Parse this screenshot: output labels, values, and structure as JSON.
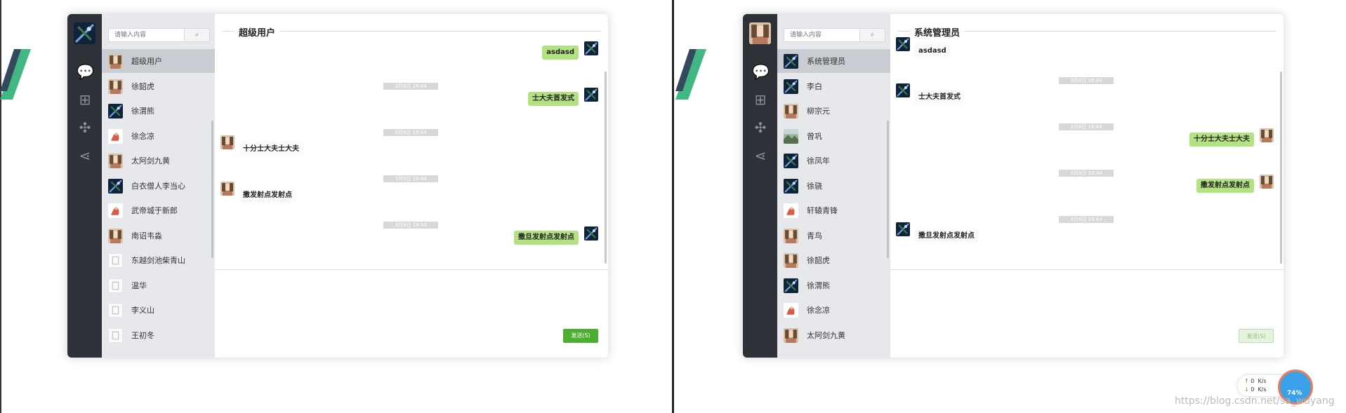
{
  "colors": {
    "rail": "#2e3238",
    "list_bg": "#e6e8ec",
    "active_item": "#c9ccd2",
    "my_bubble": "#b2e281",
    "send_button": "#4caf32"
  },
  "search": {
    "placeholder": "请输入内容",
    "icon": "search-icon"
  },
  "rail_icons": [
    "wechat-icon",
    "windows-icon",
    "pinwheel-icon",
    "share-icon"
  ],
  "left": {
    "title": "超级用户",
    "contacts": [
      {
        "name": "超级用户",
        "avatar": "girl",
        "active": true
      },
      {
        "name": "徐韶虎",
        "avatar": "girl"
      },
      {
        "name": "徐渭熊",
        "avatar": "stars"
      },
      {
        "name": "徐念凉",
        "avatar": "fox"
      },
      {
        "name": "太阿剑九黄",
        "avatar": "girl"
      },
      {
        "name": "白衣僧人李当心",
        "avatar": "stars"
      },
      {
        "name": "武帝城于新郎",
        "avatar": "fox"
      },
      {
        "name": "南诏韦淼",
        "avatar": "girl"
      },
      {
        "name": "东越剑池柴青山",
        "avatar": "blank"
      },
      {
        "name": "温华",
        "avatar": "blank"
      },
      {
        "name": "李义山",
        "avatar": "blank"
      },
      {
        "name": "王初冬",
        "avatar": "blank"
      }
    ],
    "messages": [
      {
        "kind": "msg",
        "side": "mine",
        "text": "asdasd",
        "avatar": "stars"
      },
      {
        "kind": "time",
        "text": "3月9日 19:44"
      },
      {
        "kind": "msg",
        "side": "mine",
        "text": "士大夫首发式",
        "avatar": "stars"
      },
      {
        "kind": "time",
        "text": "3月9日 19:44"
      },
      {
        "kind": "msg",
        "side": "other",
        "text": "十分士大夫士大夫",
        "avatar": "girl"
      },
      {
        "kind": "time",
        "text": "3月9日 19:44"
      },
      {
        "kind": "msg",
        "side": "other",
        "text": "撒发射点发射点",
        "avatar": "girl"
      },
      {
        "kind": "time",
        "text": "3月9日 19:44"
      },
      {
        "kind": "msg",
        "side": "mine",
        "text": "撒旦发射点发射点",
        "avatar": "stars"
      }
    ],
    "send_label": "发送(S)",
    "send_enabled": true
  },
  "right": {
    "title": "系统管理员",
    "contacts": [
      {
        "name": "系统管理员",
        "avatar": "stars",
        "active": true
      },
      {
        "name": "李白",
        "avatar": "stars"
      },
      {
        "name": "柳宗元",
        "avatar": "girl"
      },
      {
        "name": "曾巩",
        "avatar": "landscape"
      },
      {
        "name": "徐凤年",
        "avatar": "stars"
      },
      {
        "name": "徐骁",
        "avatar": "stars"
      },
      {
        "name": "轩辕青锋",
        "avatar": "fox"
      },
      {
        "name": "青鸟",
        "avatar": "girl"
      },
      {
        "name": "徐韶虎",
        "avatar": "girl"
      },
      {
        "name": "徐渭熊",
        "avatar": "stars"
      },
      {
        "name": "徐念凉",
        "avatar": "fox"
      },
      {
        "name": "太阿剑九黄",
        "avatar": "girl"
      }
    ],
    "messages": [
      {
        "kind": "msg",
        "side": "other",
        "text": "asdasd",
        "avatar": "stars"
      },
      {
        "kind": "time",
        "text": "3月9日 19:44"
      },
      {
        "kind": "msg",
        "side": "other",
        "text": "士大夫首发式",
        "avatar": "stars"
      },
      {
        "kind": "time",
        "text": "3月9日 19:44"
      },
      {
        "kind": "msg",
        "side": "mine",
        "text": "十分士大夫士大夫",
        "avatar": "girl"
      },
      {
        "kind": "time",
        "text": "3月9日 19:44"
      },
      {
        "kind": "msg",
        "side": "mine",
        "text": "撒发射点发射点",
        "avatar": "girl"
      },
      {
        "kind": "time",
        "text": "3月9日 19:44"
      },
      {
        "kind": "msg",
        "side": "other",
        "text": "撒旦发射点发射点",
        "avatar": "stars"
      }
    ],
    "send_label": "发送(S)",
    "send_enabled": false
  },
  "net_widget": {
    "up": "0",
    "down": "0",
    "unit": "K/s",
    "percent": "74%"
  },
  "watermark": "https://blog.csdn.net/sa_wuyang"
}
